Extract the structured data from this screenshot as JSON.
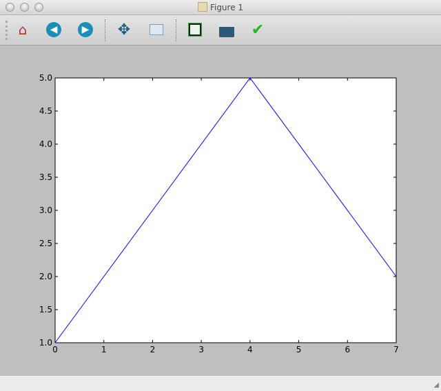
{
  "window": {
    "title": "Figure 1"
  },
  "toolbar": {
    "buttons": [
      {
        "name": "home",
        "icon": "home-icon"
      },
      {
        "name": "back",
        "icon": "arrow-left-icon"
      },
      {
        "name": "forward",
        "icon": "arrow-right-icon"
      },
      {
        "name": "pan",
        "icon": "move-icon"
      },
      {
        "name": "zoom",
        "icon": "zoom-rect-icon"
      },
      {
        "name": "subplots",
        "icon": "subplots-icon"
      },
      {
        "name": "save",
        "icon": "floppy-icon"
      },
      {
        "name": "edit",
        "icon": "checkmark-icon"
      }
    ]
  },
  "chart_data": {
    "type": "line",
    "title": "",
    "xlabel": "",
    "ylabel": "",
    "x": [
      0,
      4,
      7
    ],
    "series": [
      {
        "name": "line",
        "values": [
          1,
          5,
          2
        ],
        "color": "#0000ff"
      }
    ],
    "xlim": [
      0,
      7
    ],
    "ylim": [
      1.0,
      5.0
    ],
    "xticks": [
      "0",
      "1",
      "2",
      "3",
      "4",
      "5",
      "6",
      "7"
    ],
    "yticks": [
      "1.0",
      "1.5",
      "2.0",
      "2.5",
      "3.0",
      "3.5",
      "4.0",
      "4.5",
      "5.0"
    ],
    "grid": false
  }
}
